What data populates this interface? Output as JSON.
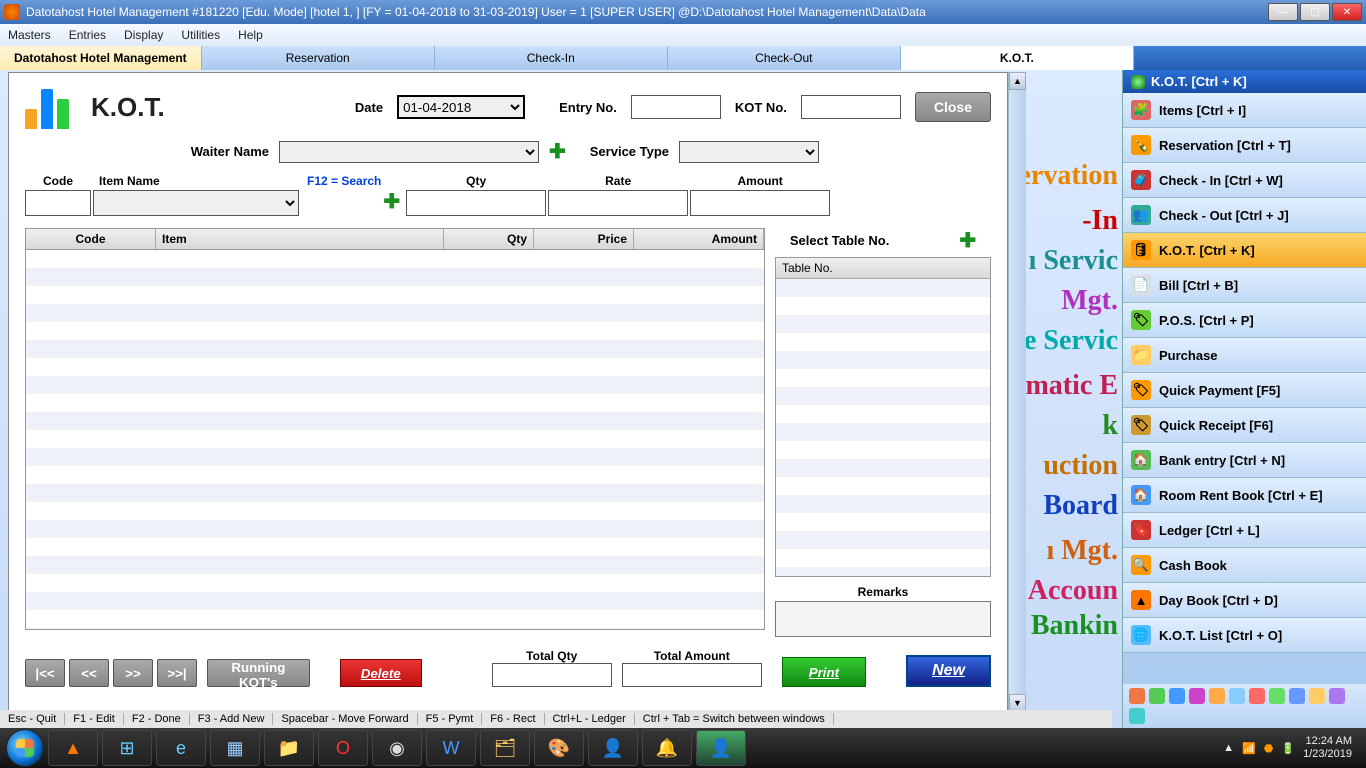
{
  "titlebar": "Datotahost Hotel Management #181220  [Edu. Mode]  [hotel 1, ] [FY = 01-04-2018 to 31-03-2019] User = 1 [SUPER USER]  @D:\\Datotahost Hotel Management\\Data\\Data",
  "menu": {
    "masters": "Masters",
    "entries": "Entries",
    "display": "Display",
    "utilities": "Utilities",
    "help": "Help"
  },
  "tabs": {
    "app": "Datotahost Hotel Management",
    "reservation": "Reservation",
    "checkin": "Check-In",
    "checkout": "Check-Out",
    "kot": "K.O.T."
  },
  "kot": {
    "title": "K.O.T.",
    "close": "Close",
    "date_label": "Date",
    "date_value": "01-04-2018",
    "entry_label": "Entry No.",
    "kotno_label": "KOT No.",
    "waiter_label": "Waiter Name",
    "service_label": "Service Type",
    "searchhint": "F12 = Search",
    "cols": {
      "code": "Code",
      "itemname": "Item Name",
      "qty": "Qty",
      "rate": "Rate",
      "amount": "Amount"
    },
    "grid": {
      "code": "Code",
      "item": "Item",
      "qty": "Qty",
      "price": "Price",
      "amount": "Amount"
    },
    "tablepanel": {
      "title": "Select Table No.",
      "col": "Table No."
    },
    "remarks": "Remarks",
    "totalqty": "Total Qty",
    "totalamount": "Total Amount",
    "nav": {
      "first": "|<<",
      "prev": "<<",
      "next": ">>",
      "last": ">>|"
    },
    "running": "Running KOT's",
    "delete": "Delete",
    "print": "Print",
    "new": "New"
  },
  "side": {
    "header": "K.O.T. [Ctrl + K]",
    "items": [
      {
        "label": "Items [Ctrl + I]"
      },
      {
        "label": "Reservation [Ctrl + T]"
      },
      {
        "label": "Check - In [Ctrl + W]"
      },
      {
        "label": "Check - Out [Ctrl + J]"
      },
      {
        "label": "K.O.T. [Ctrl + K]"
      },
      {
        "label": "Bill [Ctrl + B]"
      },
      {
        "label": "P.O.S. [Ctrl + P]"
      },
      {
        "label": "Purchase"
      },
      {
        "label": "Quick Payment [F5]"
      },
      {
        "label": "Quick Receipt [F6]"
      },
      {
        "label": "Bank entry [Ctrl + N]"
      },
      {
        "label": "Room Rent Book [Ctrl + E]"
      },
      {
        "label": "Ledger [Ctrl + L]"
      },
      {
        "label": "Cash Book"
      },
      {
        "label": "Day Book [Ctrl + D]"
      },
      {
        "label": "K.O.T. List [Ctrl + O]"
      }
    ]
  },
  "hints": {
    "esc": "Esc - Quit",
    "f1": "F1 - Edit",
    "f2": "F2 - Done",
    "f3": "F3 - Add New",
    "space": "Spacebar - Move Forward",
    "f5": "F5 - Pymt",
    "f6": "F6 - Rect",
    "ctrl_l": "Ctrl+L - Ledger",
    "ctrl_tab": "Ctrl + Tab = Switch between windows"
  },
  "clock": {
    "time": "12:24 AM",
    "date": "1/23/2019"
  },
  "bg": {
    "servation": "ervation",
    "in": "-In",
    "servic": "ı Servic",
    "mgt": "Mgt.",
    "eservic": "e Servic",
    "matic": "matic E",
    "k": "k",
    "uction": "uction",
    "board": "Board",
    "hmgt": "ı Mgt.",
    "account": "Accoun",
    "bankin": "Bankin"
  }
}
